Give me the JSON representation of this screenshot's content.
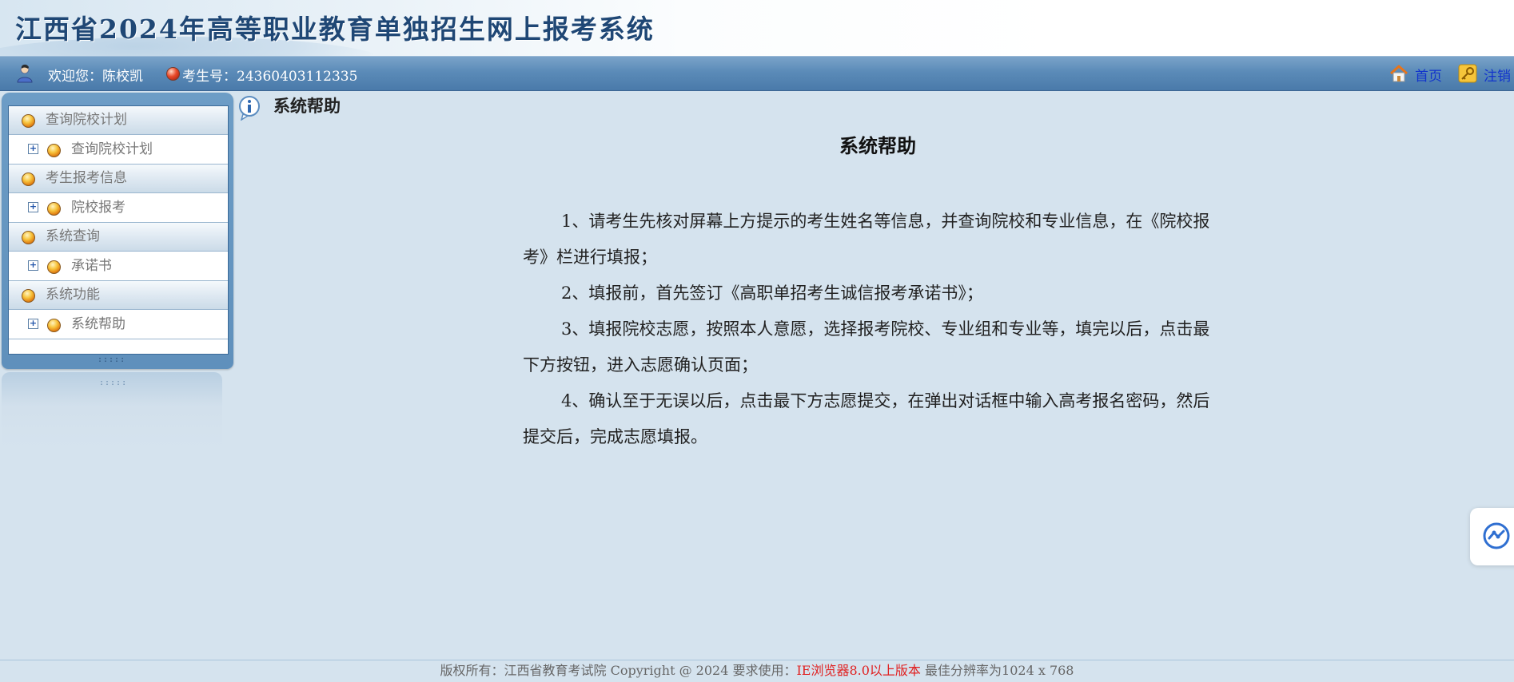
{
  "header": {
    "title": "江西省2024年高等职业教育单独招生网上报考系统"
  },
  "infobar": {
    "welcome": "欢迎您：陈校凯",
    "exam_no": "考生号：24360403112335",
    "home_label": "首页",
    "logout_label": "注销"
  },
  "sidebar": {
    "groups": [
      {
        "label": "查询院校计划",
        "items": [
          {
            "label": "查询院校计划"
          }
        ]
      },
      {
        "label": "考生报考信息",
        "items": [
          {
            "label": "院校报考"
          }
        ]
      },
      {
        "label": "系统查询",
        "items": [
          {
            "label": "承诺书"
          }
        ]
      },
      {
        "label": "系统功能",
        "items": [
          {
            "label": "系统帮助"
          }
        ]
      }
    ],
    "grip": ":::::"
  },
  "content": {
    "section_title": "系统帮助",
    "doc_title": "系统帮助",
    "paragraphs": [
      "1、请考生先核对屏幕上方提示的考生姓名等信息，并查询院校和专业信息，在《院校报考》栏进行填报；",
      "2、填报前，首先签订《高职单招考生诚信报考承诺书》；",
      "3、填报院校志愿，按照本人意愿，选择报考院校、专业组和专业等，填完以后，点击最下方按钮，进入志愿确认页面；",
      "4、确认至于无误以后，点击最下方志愿提交，在弹出对话框中输入高考报名密码，然后提交后，完成志愿填报。"
    ]
  },
  "footer": {
    "copyright": "版权所有：江西省教育考试院 Copyright @ 2024 要求使用：",
    "requirement": "IE浏览器8.0以上版本",
    "resolution": " 最佳分辨率为1024 x 768"
  },
  "colors": {
    "banner_title": "#1f4775",
    "infobar": "#5b8bb8",
    "page_bg": "#d5e3ee",
    "footer_requirement": "#e02020"
  },
  "icons": [
    "user-icon",
    "exam-id-icon",
    "home-icon",
    "logout-key-icon",
    "info-help-icon",
    "expand-plus-icon",
    "orb-bullet-icon",
    "assistant-float-icon"
  ]
}
